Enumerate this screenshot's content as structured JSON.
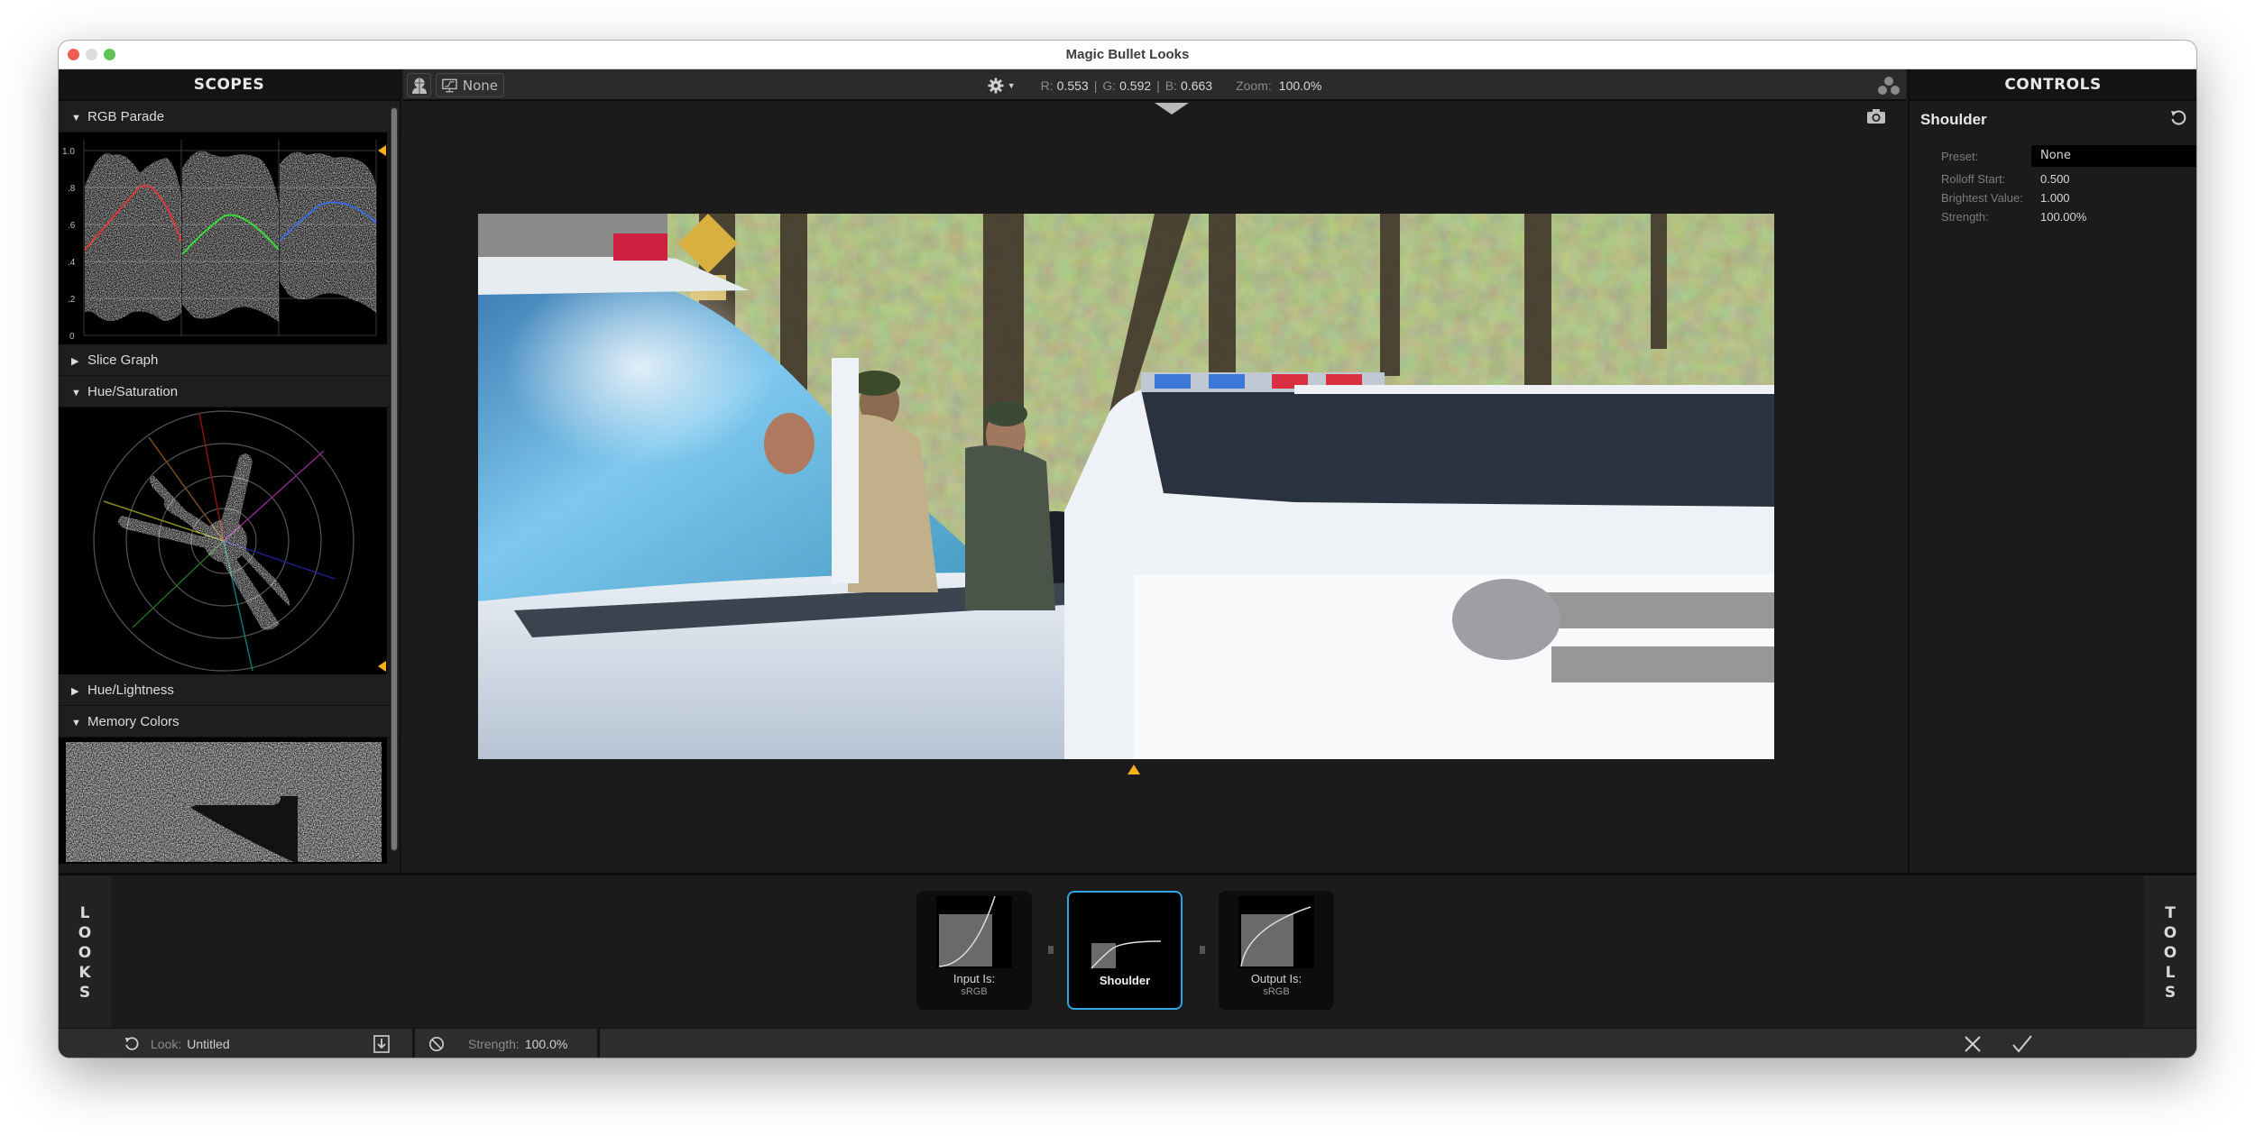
{
  "window": {
    "title": "Magic Bullet Looks",
    "traffic_lights": [
      "close",
      "minimize",
      "maximize"
    ]
  },
  "scopes": {
    "header": "SCOPES",
    "sections": [
      {
        "label": "RGB Parade",
        "expanded": true,
        "y_ticks": [
          "1.0",
          ".8",
          ".6",
          ".4",
          ".2",
          "0"
        ]
      },
      {
        "label": "Slice Graph",
        "expanded": false
      },
      {
        "label": "Hue/Saturation",
        "expanded": true
      },
      {
        "label": "Hue/Lightness",
        "expanded": false
      },
      {
        "label": "Memory Colors",
        "expanded": true
      }
    ]
  },
  "toolbar": {
    "person_icon": "person-grid-icon",
    "overlay_icon": "monitor-curve-icon",
    "overlay_label": "None",
    "settings_icon": "gear-icon",
    "readout": {
      "r_label": "R:",
      "r_value": "0.553",
      "g_label": "G:",
      "g_value": "0.592",
      "b_label": "B:",
      "b_value": "0.663",
      "zoom_label": "Zoom:",
      "zoom_value": "100.0%"
    },
    "looks_icon": "three-dots-cluster-icon",
    "snapshot_icon": "camera-icon"
  },
  "viewer": {
    "split_position": 0.507
  },
  "controls": {
    "header": "CONTROLS",
    "tool_name": "Shoulder",
    "reset_icon": "reset-icon",
    "preset_label": "Preset:",
    "preset_value": "None",
    "params": [
      {
        "label": "Rolloff Start:",
        "value": "0.500"
      },
      {
        "label": "Brightest Value:",
        "value": "1.000"
      },
      {
        "label": "Strength:",
        "value": "100.00%"
      }
    ]
  },
  "tool_chain": {
    "left_tab": [
      "L",
      "O",
      "O",
      "K",
      "S"
    ],
    "right_tab": [
      "T",
      "O",
      "O",
      "L",
      "S"
    ],
    "nodes": [
      {
        "label": "Input Is:",
        "sub": "sRGB",
        "selected": false
      },
      {
        "label": "Shoulder",
        "sub": "",
        "selected": true
      },
      {
        "label": "Output Is:",
        "sub": "sRGB",
        "selected": false
      }
    ]
  },
  "statusbar": {
    "look_label": "Look:",
    "look_value": "Untitled",
    "strength_label": "Strength:",
    "strength_value": "100.0%",
    "cancel_icon": "close-x-icon",
    "apply_icon": "checkmark-icon"
  },
  "colors": {
    "accent_blue": "#2ea6e6",
    "marker_yellow": "#f5b01b"
  }
}
